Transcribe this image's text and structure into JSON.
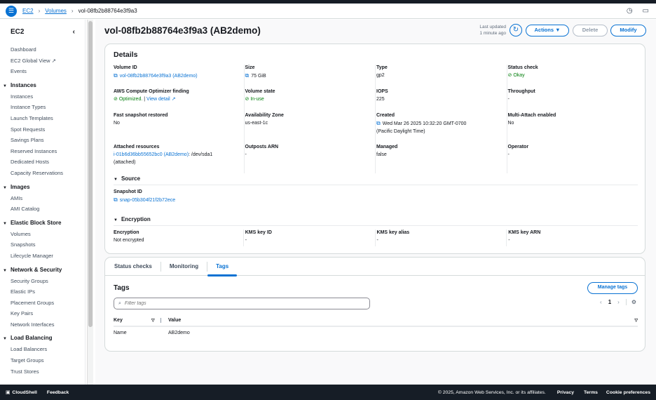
{
  "breadcrumb": {
    "items": [
      "EC2",
      "Volumes"
    ],
    "current": "vol-08fb2b88764e3f9a3"
  },
  "sidebar": {
    "title": "EC2",
    "top_items": [
      "Dashboard",
      "EC2 Global View",
      "Events"
    ],
    "sections": [
      {
        "title": "Instances",
        "items": [
          "Instances",
          "Instance Types",
          "Launch Templates",
          "Spot Requests",
          "Savings Plans",
          "Reserved Instances",
          "Dedicated Hosts",
          "Capacity Reservations"
        ]
      },
      {
        "title": "Images",
        "items": [
          "AMIs",
          "AMI Catalog"
        ]
      },
      {
        "title": "Elastic Block Store",
        "items": [
          "Volumes",
          "Snapshots",
          "Lifecycle Manager"
        ]
      },
      {
        "title": "Network & Security",
        "items": [
          "Security Groups",
          "Elastic IPs",
          "Placement Groups",
          "Key Pairs",
          "Network Interfaces"
        ]
      },
      {
        "title": "Load Balancing",
        "items": [
          "Load Balancers",
          "Target Groups",
          "Trust Stores"
        ]
      }
    ]
  },
  "header": {
    "title": "vol-08fb2b88764e3f9a3 (AB2demo)",
    "last_updated_label": "Last updated",
    "last_updated_value": "1 minute ago",
    "actions": "Actions",
    "delete": "Delete",
    "modify": "Modify"
  },
  "details": {
    "title": "Details",
    "volume_id_label": "Volume ID",
    "volume_id": "vol-08fb2b88764e3f9a3 (AB2demo)",
    "optimizer_label": "AWS Compute Optimizer finding",
    "optimizer_value": "Optimized.",
    "optimizer_link": "View detail",
    "fast_snapshot_label": "Fast snapshot restored",
    "fast_snapshot": "No",
    "attached_label": "Attached resources",
    "attached_link": "i-01b6d36bb55652bc0 (AB2demo)",
    "attached_dev": ": /dev/sda1",
    "attached_state": "(attached)",
    "size_label": "Size",
    "size": "75 GiB",
    "state_label": "Volume state",
    "state": "In-use",
    "az_label": "Availability Zone",
    "az": "us-east-1c",
    "outposts_label": "Outposts ARN",
    "outposts": "-",
    "type_label": "Type",
    "type": "gp2",
    "iops_label": "IOPS",
    "iops": "225",
    "created_label": "Created",
    "created": "Wed Mar 26 2025 10:32:20 GMT-0700",
    "created_tz": "(Pacific Daylight Time)",
    "managed_label": "Managed",
    "managed": "false",
    "status_label": "Status check",
    "status": "Okay",
    "throughput_label": "Throughput",
    "throughput": "-",
    "multi_label": "Multi-Attach enabled",
    "multi": "No",
    "operator_label": "Operator",
    "operator": "-",
    "source_title": "Source",
    "snapshot_label": "Snapshot ID",
    "snapshot": "snap-05b304f21f2b72ece",
    "encryption_title": "Encryption",
    "encryption": [
      {
        "label": "Encryption",
        "value": "Not encrypted"
      },
      {
        "label": "KMS key ID",
        "value": "-"
      },
      {
        "label": "KMS key alias",
        "value": "-"
      },
      {
        "label": "KMS key ARN",
        "value": "-"
      }
    ]
  },
  "tabs": [
    "Status checks",
    "Monitoring",
    "Tags"
  ],
  "tags": {
    "title": "Tags",
    "manage": "Manage tags",
    "filter_placeholder": "Filter tags",
    "page": "1",
    "columns": [
      "Key",
      "Value"
    ],
    "rows": [
      {
        "key": "Name",
        "value": "AB2demo"
      }
    ]
  },
  "footer": {
    "cloudshell": "CloudShell",
    "feedback": "Feedback",
    "copyright": "© 2025, Amazon Web Services, Inc. or its affiliates.",
    "privacy": "Privacy",
    "terms": "Terms",
    "cookies": "Cookie preferences"
  }
}
